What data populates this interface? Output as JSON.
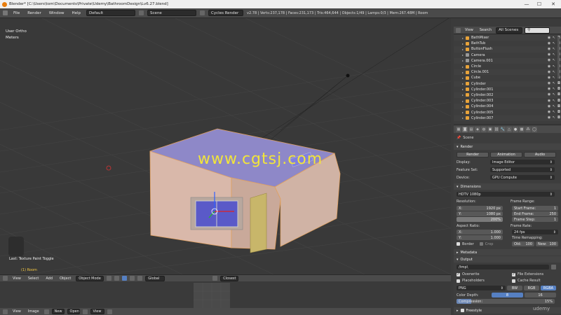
{
  "window": {
    "title": "Blender* [C:\\Users\\tom\\Documents\\Private\\Udemy\\BathroomDesign\\Lv6.27.blend]",
    "minimize": "—",
    "maximize": "☐",
    "close": "✕"
  },
  "info_header": {
    "menus": [
      "File",
      "Render",
      "Window",
      "Help"
    ],
    "layout": "Default",
    "scene": "Scene",
    "engine": "Cycles Render",
    "stats": "v2.78 | Verts:237,178 | Faces:231,173 | Tris:464,644 | Objects:1/49 | Lamps:0/3 | Mem:267.48M | Room"
  },
  "viewport": {
    "view_name": "User Ortho",
    "units": "Meters",
    "last_op": "Last: Texture Paint Toggle",
    "active_object": "(1) Room",
    "watermark": "www.cgtsj.com",
    "watermark_color": "#f2e53a",
    "grid_color": "#444444"
  },
  "viewport_header": {
    "menus": [
      "View",
      "Select",
      "Add",
      "Object"
    ],
    "mode": "Object Mode",
    "orientation": "Global",
    "pivot": "Closest"
  },
  "image_header": {
    "menus": [
      "View",
      "Image"
    ],
    "new_label": "New",
    "open_label": "Open",
    "view_mode": "View"
  },
  "outliner": {
    "header": {
      "view": "View",
      "search": "Search",
      "filter": "All Scenes"
    },
    "items": [
      "BathMixer",
      "BathTub",
      "ButtonFlush",
      "Camera",
      "Camera.001",
      "Circle",
      "Circle.001",
      "Cube",
      "Cylinder",
      "Cylinder.001",
      "Cylinder.002",
      "Cylinder.003",
      "Cylinder.004",
      "Cylinder.005",
      "Cylinder.007"
    ]
  },
  "properties": {
    "breadcrumb": "Scene",
    "render_panel": {
      "title": "Render",
      "render_btn": "Render",
      "animation_btn": "Animation",
      "audio_btn": "Audio",
      "display_label": "Display:",
      "display_value": "Image Editor",
      "feature_set_label": "Feature Set:",
      "feature_set_value": "Supported",
      "device_label": "Device:",
      "device_value": "GPU Compute"
    },
    "dimensions_panel": {
      "title": "Dimensions",
      "preset": "HDTV 1080p",
      "resolution_label": "Resolution:",
      "res_x_label": "X:",
      "res_x": "1920 px",
      "res_y_label": "Y:",
      "res_y": "1080 px",
      "res_pct": "200%",
      "frame_range_label": "Frame Range:",
      "start_label": "Start Frame:",
      "start": "1",
      "end_label": "End Frame:",
      "end": "250",
      "step_label": "Frame Step:",
      "step": "1",
      "aspect_label": "Aspect Ratio:",
      "asp_x_label": "X:",
      "asp_x": "1.000",
      "asp_y_label": "Y:",
      "asp_y": "1.000",
      "frame_rate_label": "Frame Rate:",
      "fps": "24 fps",
      "border_label": "Border",
      "crop_label": "Crop",
      "remap_label": "Time Remapping:",
      "old_label": "Old:",
      "old": "100",
      "new_label": "New:",
      "new": "100"
    },
    "metadata_panel": {
      "title": "Metadata"
    },
    "output_panel": {
      "title": "Output",
      "path": "/tmp\\",
      "overwrite": "Overwrite",
      "file_ext": "File Extensions",
      "placeholders": "Placeholders",
      "cache_result": "Cache Result",
      "format": "PNG",
      "bw": "BW",
      "rgb": "RGB",
      "rgba": "RGBA",
      "color_depth_label": "Color Depth:",
      "depth_8": "8",
      "depth_16": "16",
      "compression_label": "Compression:",
      "compression_value": "15%"
    },
    "freestyle_panel": {
      "title": "Freestyle"
    }
  },
  "branding": {
    "udemy": "udemy"
  }
}
